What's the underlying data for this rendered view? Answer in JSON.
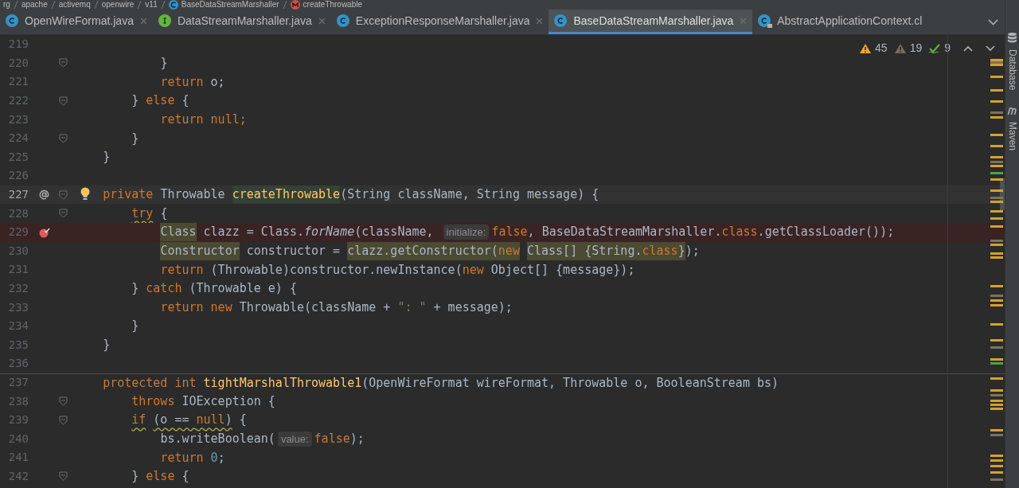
{
  "breadcrumb": [
    {
      "label": "rg",
      "kind": "package"
    },
    {
      "label": "apache",
      "kind": "package"
    },
    {
      "label": "activemq",
      "kind": "package"
    },
    {
      "label": "openwire",
      "kind": "package"
    },
    {
      "label": "v11",
      "kind": "package"
    },
    {
      "label": "BaseDataStreamMarshaller",
      "kind": "class"
    },
    {
      "label": "createThrowable",
      "kind": "method"
    }
  ],
  "tabs": [
    {
      "label": "OpenWireFormat.java",
      "kind": "class",
      "selected": false,
      "closable": true
    },
    {
      "label": "DataStreamMarshaller.java",
      "kind": "interface",
      "selected": false,
      "closable": true
    },
    {
      "label": "ExceptionResponseMarshaller.java",
      "kind": "class",
      "selected": false,
      "closable": true
    },
    {
      "label": "BaseDataStreamMarshaller.java",
      "kind": "class",
      "selected": true,
      "closable": true
    },
    {
      "label": "AbstractApplicationContext.cl",
      "kind": "class-locked",
      "selected": false,
      "closable": false
    }
  ],
  "inspections": [
    {
      "kind": "warning",
      "count": "45"
    },
    {
      "kind": "weak-warning",
      "count": "19"
    },
    {
      "kind": "typo",
      "count": "9"
    }
  ],
  "tool_windows": [
    {
      "label": "Database",
      "kind": "database"
    },
    {
      "label": "Maven",
      "kind": "maven"
    }
  ],
  "lines": [
    {
      "number": "219",
      "kind": "code",
      "fold": false
    },
    {
      "number": "220",
      "kind": "code",
      "fold": true,
      "tokens": [
        {
          "text": "            }",
          "kind": "plain"
        }
      ]
    },
    {
      "number": "221",
      "kind": "code",
      "fold": false,
      "tokens": [
        {
          "text": "            return",
          "kind": "keyword"
        },
        {
          "text": " o;",
          "kind": "plain"
        }
      ]
    },
    {
      "number": "222",
      "kind": "code",
      "fold": true,
      "tokens": [
        {
          "text": "        } ",
          "kind": "plain"
        },
        {
          "text": "else",
          "kind": "keyword"
        },
        {
          "text": " {",
          "kind": "plain"
        }
      ]
    },
    {
      "number": "223",
      "kind": "code",
      "fold": false,
      "tokens": [
        {
          "text": "            return null;",
          "kind": "keyword"
        }
      ]
    },
    {
      "number": "224",
      "kind": "code",
      "fold": true,
      "tokens": [
        {
          "text": "        }",
          "kind": "plain"
        }
      ]
    },
    {
      "number": "225",
      "kind": "code",
      "fold": false,
      "tokens": [
        {
          "text": "    }",
          "kind": "plain"
        }
      ]
    },
    {
      "number": "226",
      "kind": "code",
      "fold": false
    },
    {
      "number": "227",
      "kind": "current-declaration",
      "fold": true,
      "tokens": [
        {
          "text": "    private",
          "kind": "keyword"
        },
        {
          "text": " Throwable ",
          "kind": "plain"
        },
        {
          "text": "createThrowable",
          "kind": "method-decl",
          "marked": true
        },
        {
          "text": "(String className, String message) {",
          "kind": "plain"
        }
      ]
    },
    {
      "number": "228",
      "kind": "code",
      "fold": true,
      "tokens": [
        {
          "text": "        try",
          "kind": "keyword",
          "squiggly": true
        },
        {
          "text": " {",
          "kind": "plain"
        }
      ]
    },
    {
      "number": "229",
      "kind": "breakpoint",
      "fold": false,
      "tokens": [
        {
          "text": "            Class",
          "kind": "plain",
          "marked": true
        },
        {
          "text": " clazz = Class.",
          "kind": "plain"
        },
        {
          "text": "forName",
          "kind": "static-call"
        },
        {
          "text": "(className, ",
          "kind": "plain"
        },
        {
          "text": "initialize:",
          "kind": "inlay-hint"
        },
        {
          "text": "false",
          "kind": "keyword"
        },
        {
          "text": ", BaseDataStreamMarshaller.",
          "kind": "plain"
        },
        {
          "text": "class",
          "kind": "keyword"
        },
        {
          "text": ".getClassLoader());",
          "kind": "plain"
        }
      ]
    },
    {
      "number": "230",
      "kind": "code",
      "fold": false,
      "tokens": [
        {
          "text": "            Constructor",
          "kind": "plain",
          "marked": true
        },
        {
          "text": " constructor = ",
          "kind": "plain"
        },
        {
          "text": "clazz.getConstructor(",
          "kind": "plain",
          "marked": true
        },
        {
          "text": "new",
          "kind": "keyword",
          "marked": true
        },
        {
          "text": " Class[] {String.",
          "kind": "plain",
          "marked": true
        },
        {
          "text": "class",
          "kind": "keyword",
          "marked": true
        },
        {
          "text": "}",
          "kind": "plain",
          "marked": true
        },
        {
          "text": ");",
          "kind": "plain"
        }
      ]
    },
    {
      "number": "231",
      "kind": "code",
      "fold": false,
      "tokens": [
        {
          "text": "            return",
          "kind": "keyword"
        },
        {
          "text": " (Throwable)constructor.newInstance(",
          "kind": "plain"
        },
        {
          "text": "new",
          "kind": "keyword"
        },
        {
          "text": " Object[] {message});",
          "kind": "plain"
        }
      ]
    },
    {
      "number": "232",
      "kind": "code",
      "fold": false,
      "tokens": [
        {
          "text": "        } ",
          "kind": "plain"
        },
        {
          "text": "catch",
          "kind": "keyword"
        },
        {
          "text": " (Throwable e) {",
          "kind": "plain"
        }
      ]
    },
    {
      "number": "233",
      "kind": "code",
      "fold": false,
      "tokens": [
        {
          "text": "            return new",
          "kind": "keyword"
        },
        {
          "text": " Throwable(className + ",
          "kind": "plain"
        },
        {
          "text": "\": \"",
          "kind": "string"
        },
        {
          "text": " + message);",
          "kind": "plain"
        }
      ]
    },
    {
      "number": "234",
      "kind": "code",
      "fold": false,
      "tokens": [
        {
          "text": "        }",
          "kind": "plain"
        }
      ]
    },
    {
      "number": "235",
      "kind": "code",
      "fold": false,
      "tokens": [
        {
          "text": "    }",
          "kind": "plain"
        }
      ]
    },
    {
      "number": "236",
      "kind": "code",
      "fold": false
    },
    {
      "number": "237",
      "kind": "separated",
      "fold": false,
      "tokens": [
        {
          "text": "    protected int",
          "kind": "keyword"
        },
        {
          "text": " tightMarshalThrowable1",
          "kind": "method-decl"
        },
        {
          "text": "(OpenWireFormat wireFormat, Throwable o, BooleanStream bs)",
          "kind": "plain"
        }
      ]
    },
    {
      "number": "238",
      "kind": "code",
      "fold": true,
      "tokens": [
        {
          "text": "        throws",
          "kind": "keyword"
        },
        {
          "text": " IOException {",
          "kind": "plain"
        }
      ]
    },
    {
      "number": "239",
      "kind": "code",
      "fold": true,
      "tokens": [
        {
          "text": "        if",
          "kind": "keyword",
          "squiggly": true
        },
        {
          "text": " (o == ",
          "kind": "plain",
          "squiggly": true
        },
        {
          "text": "null",
          "kind": "keyword",
          "squiggly": true
        },
        {
          "text": ")",
          "kind": "plain",
          "squiggly": true
        },
        {
          "text": " {",
          "kind": "plain"
        }
      ]
    },
    {
      "number": "240",
      "kind": "code",
      "fold": false,
      "tokens": [
        {
          "text": "            bs.writeBoolean(",
          "kind": "plain"
        },
        {
          "text": "value:",
          "kind": "inlay-hint"
        },
        {
          "text": "false",
          "kind": "keyword"
        },
        {
          "text": ");",
          "kind": "plain"
        }
      ]
    },
    {
      "number": "241",
      "kind": "code",
      "fold": false,
      "tokens": [
        {
          "text": "            return",
          "kind": "keyword"
        },
        {
          "text": " 0",
          "kind": "number"
        },
        {
          "text": ";",
          "kind": "plain"
        }
      ]
    },
    {
      "number": "242",
      "kind": "code",
      "fold": true,
      "tokens": [
        {
          "text": "        } ",
          "kind": "plain"
        },
        {
          "text": "else",
          "kind": "keyword"
        },
        {
          "text": " {",
          "kind": "plain"
        }
      ]
    }
  ]
}
